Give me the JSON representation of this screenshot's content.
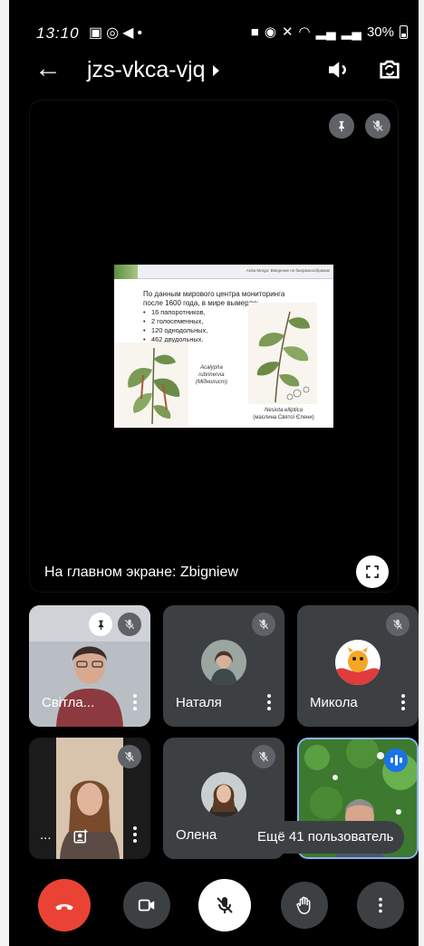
{
  "status_bar": {
    "time": "13:10",
    "left_icons": [
      "image-icon",
      "whatsapp-icon",
      "telegram-icon",
      "dot-icon"
    ],
    "right_icons": [
      "briefcase-icon",
      "alarm-icon",
      "mute-icon",
      "wifi-icon",
      "signal-icon",
      "signal-icon"
    ],
    "battery": "30%"
  },
  "header": {
    "meeting_code": "jzs-vkca-vjq"
  },
  "stage": {
    "label": "На главном экране: Zbigniew",
    "slide": {
      "header_text": "Anita Morgo: Введение по биоразнообразию",
      "intro_lines": [
        "По данным мирового центра мониторинга",
        "после 1600 года, в мире вымерло:"
      ],
      "bullets": [
        "16 папоротников,",
        "2 голосеменных,",
        "120 однодольных,",
        "462 двудольных."
      ],
      "caption_left": [
        "Acalypha",
        "rubrinervia",
        "(Міднолист)"
      ],
      "caption_right_italic": "Nesiota elliptica",
      "caption_right_plain": "(маслина Святої Єлени)"
    }
  },
  "participants": [
    {
      "name": "Світла...",
      "muted": true,
      "pinned": true
    },
    {
      "name": "Наталя",
      "muted": true
    },
    {
      "name": "Микола",
      "muted": true
    },
    {
      "name": "...",
      "muted": true,
      "presenting_icon": true
    },
    {
      "name": "Олена",
      "muted": true
    },
    {
      "name": "",
      "speaking": true
    }
  ],
  "more_participants": "Ещё 41 пользователь",
  "colors": {
    "background": "#000000",
    "tile": "#3c4043",
    "hangup": "#ea4335",
    "speaking_ring": "#1a73e8"
  }
}
